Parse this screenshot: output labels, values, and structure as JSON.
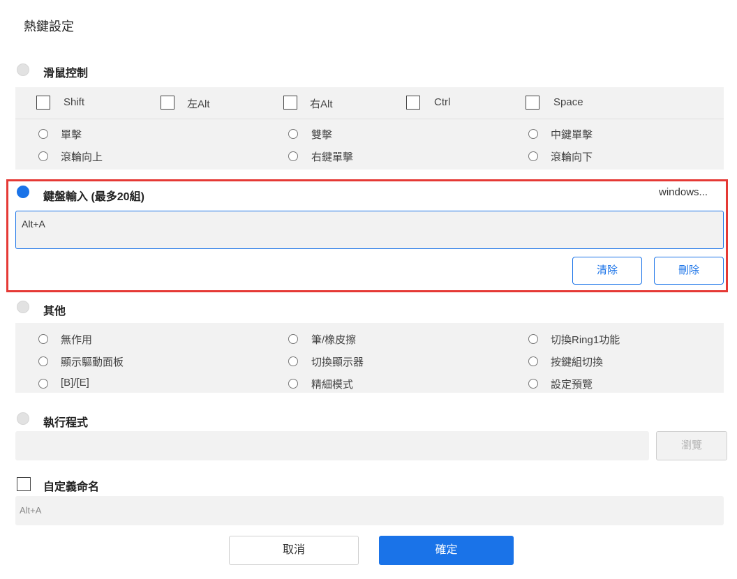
{
  "title": "熱鍵設定",
  "mouse_section": {
    "label": "滑鼠控制",
    "selected": false,
    "modifiers": [
      {
        "label": "Shift",
        "checked": false
      },
      {
        "label": "左Alt",
        "checked": false
      },
      {
        "label": "右Alt",
        "checked": false
      },
      {
        "label": "Ctrl",
        "checked": false
      },
      {
        "label": "Space",
        "checked": false
      }
    ],
    "actions": [
      "單擊",
      "滾輪向上",
      "雙擊",
      "右鍵單擊",
      "中鍵單擊",
      "滾輪向下"
    ]
  },
  "keyboard_section": {
    "label": "鍵盤輸入 (最多20組)",
    "selected": true,
    "os_label": "windows...",
    "input_value": "Alt+A",
    "clear_label": "清除",
    "delete_label": "刪除",
    "highlight_color": "#e53935"
  },
  "other_section": {
    "label": "其他",
    "selected": false,
    "options": [
      "無作用",
      "顯示驅動面板",
      "[B]/[E]",
      "筆/橡皮擦",
      "切換顯示器",
      "精細模式",
      "切換Ring1功能",
      "按鍵組切換",
      "設定預覽"
    ]
  },
  "program_section": {
    "label": "執行程式",
    "selected": false,
    "path_value": "",
    "browse_label": "瀏覽"
  },
  "custom_name": {
    "label": "自定義命名",
    "checked": false,
    "value": "Alt+A"
  },
  "footer": {
    "cancel_label": "取消",
    "ok_label": "確定"
  },
  "colors": {
    "accent": "#1a73e8",
    "panel": "#f2f2f2"
  }
}
